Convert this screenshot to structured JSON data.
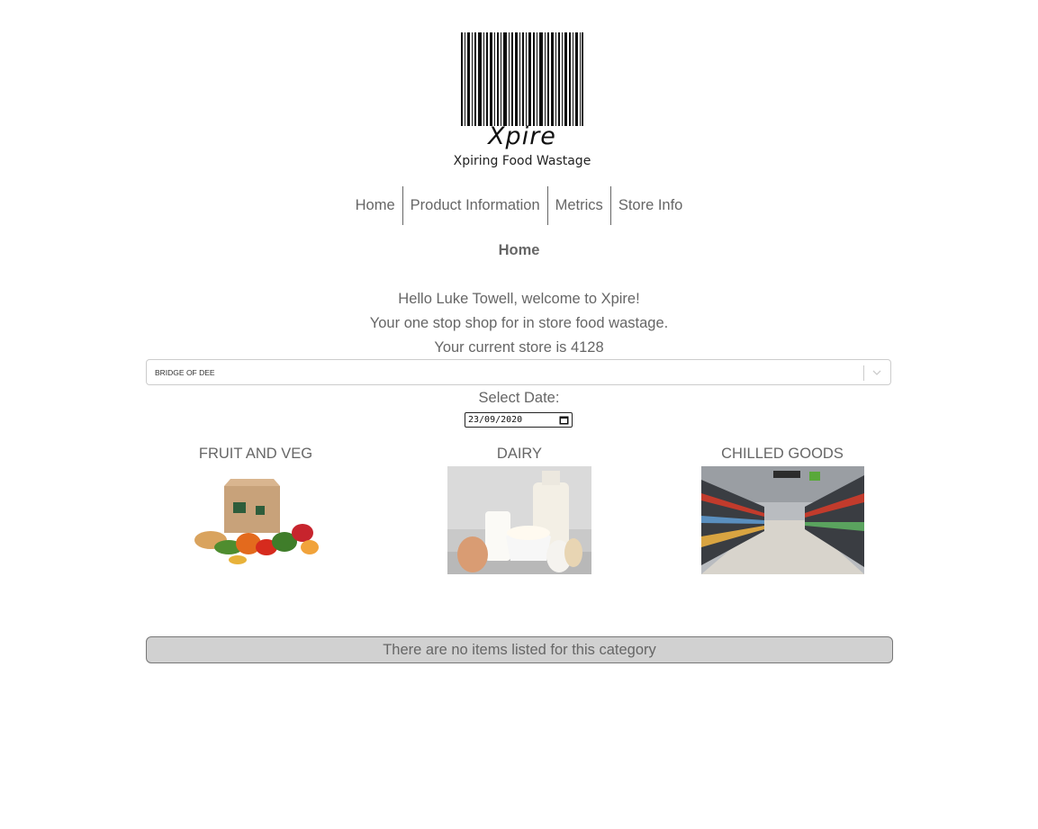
{
  "logo": {
    "word": "Xpire",
    "tagline": "Xpiring Food Wastage"
  },
  "nav": {
    "items": [
      "Home",
      "Product Information",
      "Metrics",
      "Store Info"
    ]
  },
  "page_title": "Home",
  "welcome": {
    "greeting": "Hello Luke Towell, welcome to Xpire!",
    "tagline": "Your one stop shop for in store food wastage.",
    "store": "Your current store is 4128"
  },
  "store_select": {
    "value": "BRIDGE OF DEE",
    "icon": "chevron-down-icon"
  },
  "date": {
    "label": "Select Date:",
    "value": "23/09/2020",
    "icon": "calendar-icon"
  },
  "categories": [
    {
      "title": "FRUIT AND VEG"
    },
    {
      "title": "DAIRY"
    },
    {
      "title": "CHILLED GOODS"
    }
  ],
  "notice": "There are no items listed for this category",
  "colors": {
    "text": "#666666",
    "notice_bg": "#d1d1d1",
    "border": "#cccccc"
  }
}
